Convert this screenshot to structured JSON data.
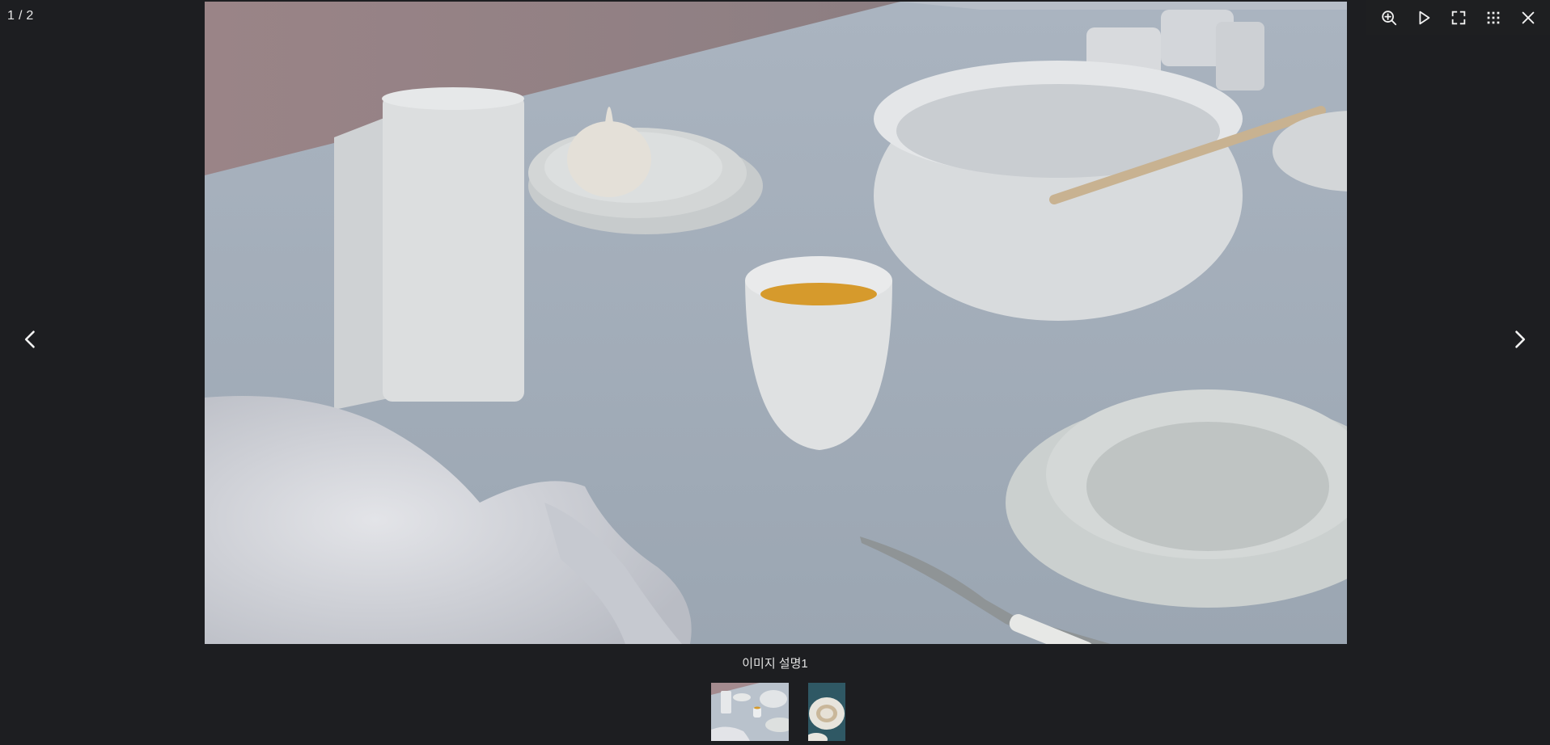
{
  "viewer": {
    "counter": "1 / 2",
    "caption": "이미지 설명1"
  },
  "toolbar": {
    "icons": [
      "zoom-in-icon",
      "play-icon",
      "fullscreen-icon",
      "grid-icon",
      "close-icon"
    ]
  },
  "navigation": {
    "icons": [
      "chevron-left-icon",
      "chevron-right-icon"
    ]
  },
  "colors": {
    "background": "#1d1e21",
    "toolbar_bg": "#1e1f22",
    "icon": "#f2f2f2"
  }
}
